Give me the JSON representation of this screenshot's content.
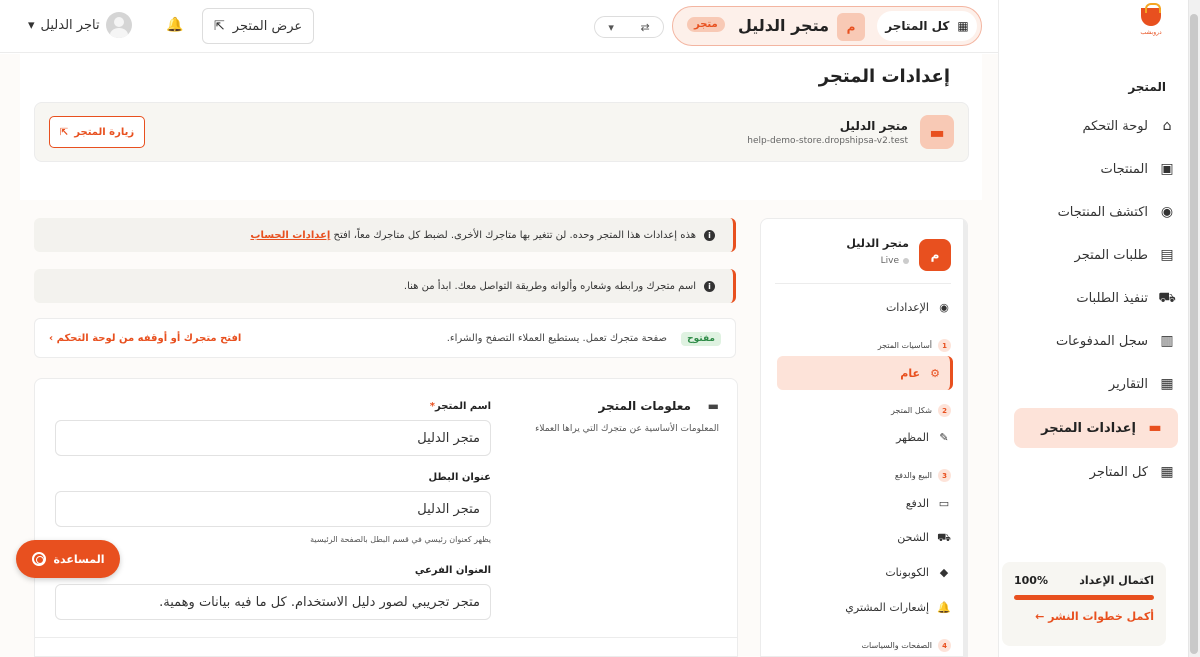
{
  "sidebar": {
    "logo_text": "دروبشب",
    "section_label": "المتجر",
    "items": [
      {
        "label": "لوحة التحكم",
        "icon": "home-icon",
        "glyph": "⌂"
      },
      {
        "label": "المنتجات",
        "icon": "box-icon",
        "glyph": "▣"
      },
      {
        "label": "اكتشف المنتجات",
        "icon": "compass-icon",
        "glyph": "◉"
      },
      {
        "label": "طلبات المتجر",
        "icon": "receipt-icon",
        "glyph": "▤"
      },
      {
        "label": "تنفيذ الطلبات",
        "icon": "truck-icon",
        "glyph": "⛟"
      },
      {
        "label": "سجل المدفوعات",
        "icon": "money-icon",
        "glyph": "▥"
      },
      {
        "label": "التقارير",
        "icon": "chart-icon",
        "glyph": "▦"
      },
      {
        "label": "إعدادات المتجر",
        "icon": "store-icon",
        "glyph": "▬"
      },
      {
        "label": "كل المتاجر",
        "icon": "grid-icon",
        "glyph": "▦"
      }
    ],
    "setup": {
      "label": "اكتمال الإعداد",
      "percent": "100%",
      "progress": 1.0,
      "cta": "أكمل خطوات النشر ←"
    }
  },
  "topbar": {
    "all_stores": "كل المتاجر",
    "store_initial": "م",
    "store_name": "متجر الدليل",
    "store_badge": "متجر",
    "view_store": "عرض المتجر",
    "user_name": "تاجر الدليل"
  },
  "page": {
    "title": "إعدادات المتجر",
    "store_title": "متجر الدليل",
    "store_url": "help-demo-store.dropshipsa-v2.test",
    "visit_btn": "زيارة المتجر"
  },
  "alerts": {
    "a1_text": "هذه إعدادات هذا المتجر وحده. لن تتغير بها متاجرك الأخرى. لضبط كل متاجرك معاً، افتح",
    "a1_link": "إعدادات الحساب",
    "a2_text": "اسم متجرك ورابطه وشعاره وألوانه وطريقة التواصل معك. ابدأ من هنا."
  },
  "status": {
    "badge": "مفتوح",
    "text": "صفحة متجرك تعمل. يستطيع العملاء التصفح والشراء.",
    "link": "افتح متجرك أو أوقفه من لوحة التحكم ›"
  },
  "settings_nav": {
    "initial": "م",
    "name": "متجر الدليل",
    "live": "Live",
    "settings": "الإعدادات",
    "sec1": "أساسيات المتجر",
    "general": "عام",
    "sec2": "شكل المتجر",
    "appearance": "المظهر",
    "sec3": "البيع والدفع",
    "payment": "الدفع",
    "shipping": "الشحن",
    "coupons": "الكوبونات",
    "notifications": "إشعارات المشتري",
    "sec4": "الصفحات والسياسات"
  },
  "form": {
    "section_title": "معلومات المتجر",
    "section_desc": "المعلومات الأساسية عن متجرك التي يراها العملاء",
    "name_label": "اسم المتجر",
    "name_value": "متجر الدليل",
    "hero_label": "عنوان البطل",
    "hero_value": "متجر الدليل",
    "hero_hint": "يظهر كعنوان رئيسي في قسم البطل بالصفحة الرئيسية",
    "sub_label": "العنوان الفرعي",
    "sub_value": "متجر تجريبي لصور دليل الاستخدام. كل ما فيه بيانات وهمية."
  },
  "help_button": "المساعدة"
}
